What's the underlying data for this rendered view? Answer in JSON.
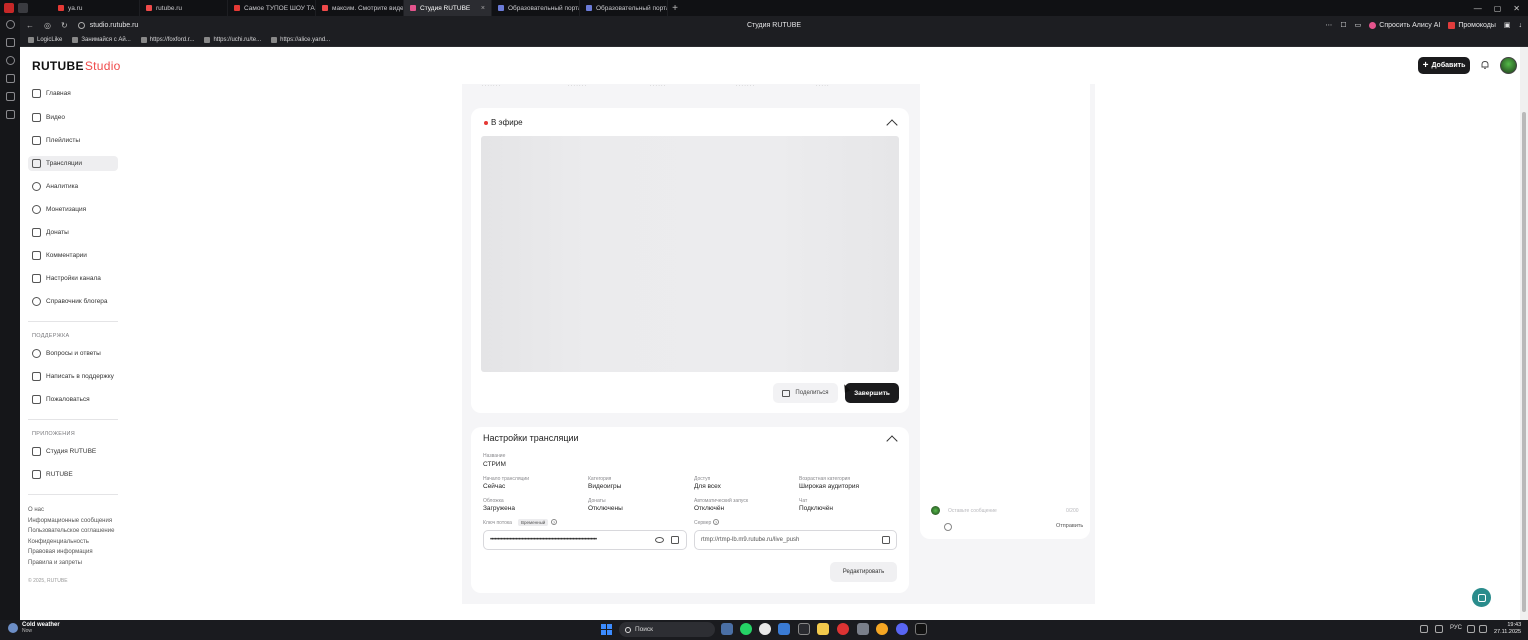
{
  "browser": {
    "tabs": [
      {
        "label": "ya.ru",
        "color": "#e53935",
        "active": false
      },
      {
        "label": "rutube.ru",
        "color": "#ef4a4a",
        "active": false
      },
      {
        "label": "Самое ТУПОЕ ШОУ ТАЛ",
        "color": "#e53935",
        "active": false
      },
      {
        "label": "максим. Смотрите виде",
        "color": "#ef4a4a",
        "active": false
      },
      {
        "label": "Студия RUTUBE",
        "color": "#e5548d",
        "active": true
      },
      {
        "label": "Образовательный портал",
        "color": "#6b7bd8",
        "active": false
      },
      {
        "label": "Образовательный портал",
        "color": "#6b7bd8",
        "active": false
      }
    ],
    "url": "studio.rutube.ru",
    "page_title": "Студия RUTUBE",
    "alice_label": "Спросить Алису AI",
    "promo_label": "Промокоды",
    "bookmarks": [
      "LogicLike",
      "Занимайся с Ай...",
      "https://foxford.r...",
      "https://uchi.ru/te...",
      "https://alice.yand..."
    ]
  },
  "app": {
    "logo_main": "RUTUBE",
    "logo_studio": "Studio",
    "add_label": "Добавить"
  },
  "sidebar": {
    "items": [
      {
        "label": "Главная",
        "name": "home"
      },
      {
        "label": "Видео",
        "name": "video"
      },
      {
        "label": "Плейлисты",
        "name": "playlists"
      },
      {
        "label": "Трансляции",
        "name": "streams",
        "active": true
      },
      {
        "label": "Аналитика",
        "name": "analytics"
      },
      {
        "label": "Монетизация",
        "name": "monetization"
      },
      {
        "label": "Донаты",
        "name": "donations"
      },
      {
        "label": "Комментарии",
        "name": "comments"
      },
      {
        "label": "Настройки канала",
        "name": "channel-settings"
      },
      {
        "label": "Справочник блогера",
        "name": "blogger-guide"
      }
    ],
    "support_label": "ПОДДЕРЖКА",
    "support_items": [
      {
        "label": "Вопросы и ответы",
        "name": "faq"
      },
      {
        "label": "Написать в поддержку",
        "name": "contact-support"
      },
      {
        "label": "Пожаловаться",
        "name": "report"
      }
    ],
    "apps_label": "ПРИЛОЖЕНИЯ",
    "apps_items": [
      {
        "label": "Студия RUTUBE",
        "name": "studio-app"
      },
      {
        "label": "RUTUBE",
        "name": "rutube-app"
      }
    ],
    "footer_links": [
      "О нас",
      "Информационные сообщения",
      "Пользовательское соглашение",
      "Конфиденциальность",
      "Правовая информация",
      "Правила и запреты"
    ],
    "copyright": "© 2025, RUTUBE"
  },
  "live": {
    "title": "В эфире",
    "share_label": "Поделиться",
    "finish_label": "Завершить"
  },
  "settings": {
    "title": "Настройки трансляции",
    "name_label": "Название",
    "name_value": "СТРИМ",
    "start_label": "Начало трансляции",
    "start_value": "Сейчас",
    "category_label": "Категория",
    "category_value": "Видеоигры",
    "access_label": "Доступ",
    "access_value": "Для всех",
    "age_label": "Возрастная категория",
    "age_value": "Широкая аудитория",
    "cover_label": "Обложка",
    "cover_value": "Загружена",
    "donations_label": "Донаты",
    "donations_value": "Отключены",
    "autostart_label": "Автоматический запуск",
    "autostart_value": "Отключён",
    "chat_label": "Чат",
    "chat_value": "Подключён",
    "key_label": "Ключ потока",
    "key_badge": "Временный",
    "key_value": "•••••••••••••••••••••••••••••••••••••••••••••••••••••••••••••••••••••••",
    "server_label": "Сервер",
    "server_value": "rtmp://rtmp-lb.m9.rutube.ru/live_push",
    "edit_label": "Редактировать"
  },
  "chat": {
    "placeholder": "Оставьте сообщение",
    "counter": "0/200",
    "send_label": "Отправить"
  },
  "taskbar": {
    "weather_title": "Cold weather",
    "weather_sub": "Now",
    "search_label": "Поиск",
    "lang": "РУС",
    "time": "19:43",
    "date": "27.11.2025"
  }
}
